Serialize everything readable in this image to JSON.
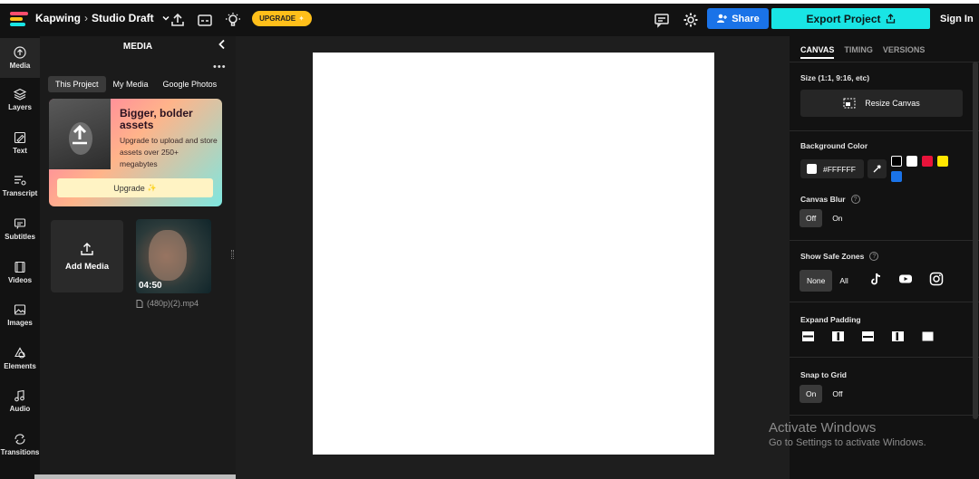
{
  "topbar": {
    "brand": "Kapwing",
    "project": "Studio Draft",
    "upgrade_label": "UPGRADE",
    "share_label": "Share",
    "export_label": "Export Project",
    "signin_label": "Sign In"
  },
  "rail": {
    "items": [
      {
        "label": "Media"
      },
      {
        "label": "Layers"
      },
      {
        "label": "Text"
      },
      {
        "label": "Transcript"
      },
      {
        "label": "Subtitles"
      },
      {
        "label": "Videos"
      },
      {
        "label": "Images"
      },
      {
        "label": "Elements"
      },
      {
        "label": "Audio"
      },
      {
        "label": "Transitions"
      }
    ]
  },
  "media_panel": {
    "title": "MEDIA",
    "tabs": [
      "This Project",
      "My Media",
      "Google Photos"
    ],
    "promo": {
      "title": "Bigger, bolder assets",
      "text": "Upgrade to upload and store assets over 250+ megabytes",
      "button": "Upgrade"
    },
    "add_media_label": "Add Media",
    "file": {
      "duration": "04:50",
      "name": "(480p)(2).mp4"
    }
  },
  "right_panel": {
    "tabs": [
      "CANVAS",
      "TIMING",
      "VERSIONS"
    ],
    "size_label": "Size (1:1, 9:16, etc)",
    "resize_label": "Resize Canvas",
    "bg_label": "Background Color",
    "bg_value": "#FFFFFF",
    "swatches": [
      "#000000",
      "#ffffff",
      "#e8133a",
      "#ffe600",
      "#1a73e8"
    ],
    "blur_label": "Canvas Blur",
    "blur_options": [
      "Off",
      "On"
    ],
    "safe_label": "Show Safe Zones",
    "safe_options": [
      "None",
      "All"
    ],
    "padding_label": "Expand Padding",
    "snap_label": "Snap to Grid",
    "snap_options": [
      "On",
      "Off"
    ]
  },
  "watermark": {
    "line1": "Activate Windows",
    "line2": "Go to Settings to activate Windows."
  },
  "colors": {
    "accent_share": "#1a73e8",
    "accent_export": "#19e5e5",
    "upgrade": "#ffbf1a"
  }
}
